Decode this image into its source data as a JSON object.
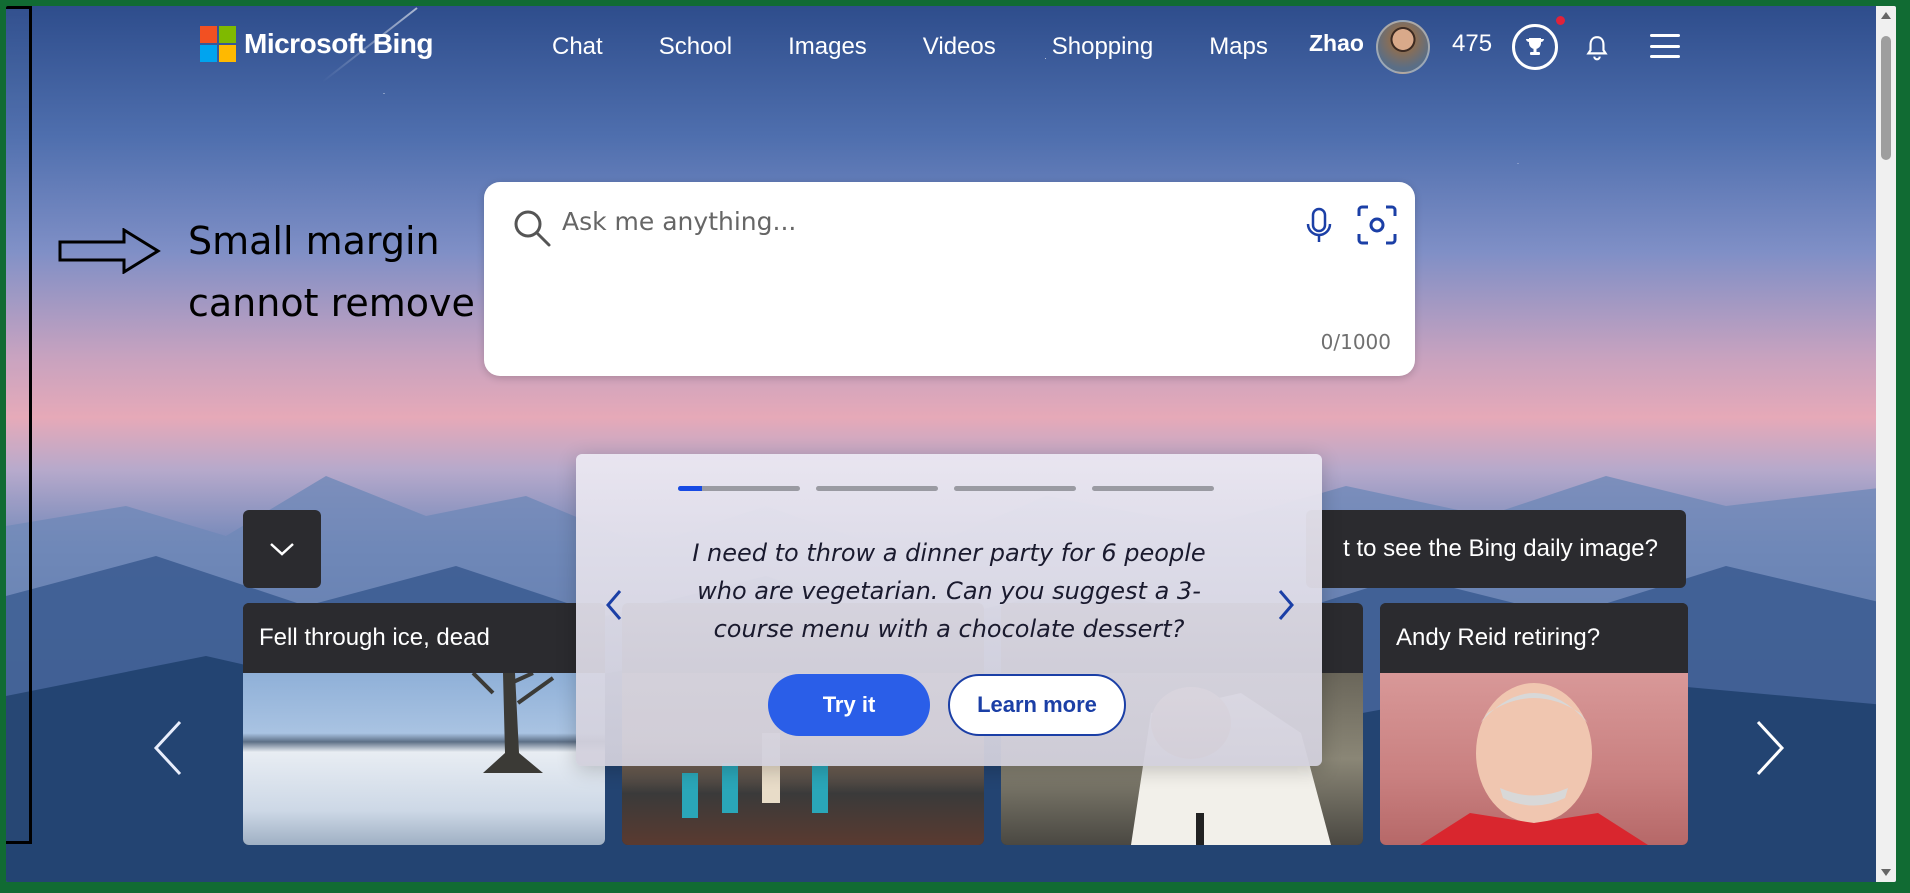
{
  "header": {
    "logo_text": "Microsoft Bing",
    "logo_colors": [
      "#f25022",
      "#7fba00",
      "#00a4ef",
      "#ffb900"
    ],
    "nav": [
      {
        "label": "Chat"
      },
      {
        "label": "School"
      },
      {
        "label": "Images"
      },
      {
        "label": "Videos"
      },
      {
        "label": "Shopping"
      },
      {
        "label": "Maps"
      }
    ],
    "user_name": "Zhao",
    "points": "475"
  },
  "annotation": {
    "line1": "Small margin",
    "line2": "cannot remove"
  },
  "search": {
    "placeholder": "Ask me anything...",
    "counter": "0/1000"
  },
  "suggestion": {
    "prompt": "I need to throw a dinner party for 6 people who are vegetarian. Can you suggest a 3-course menu with a chocolate dessert?",
    "try_label": "Try it",
    "learn_label": "Learn more",
    "pages": 4,
    "active_page": 1,
    "active_progress": 0.2
  },
  "daily_image": {
    "label": "t to see the Bing daily image?"
  },
  "cards": [
    {
      "title": "Fell through ice, dead"
    },
    {
      "title": ""
    },
    {
      "title": ""
    },
    {
      "title": "Andy Reid retiring?"
    }
  ],
  "colors": {
    "accent": "#2a5ee8",
    "card_bg": "#2b2b2f",
    "notification": "#e0223a"
  }
}
